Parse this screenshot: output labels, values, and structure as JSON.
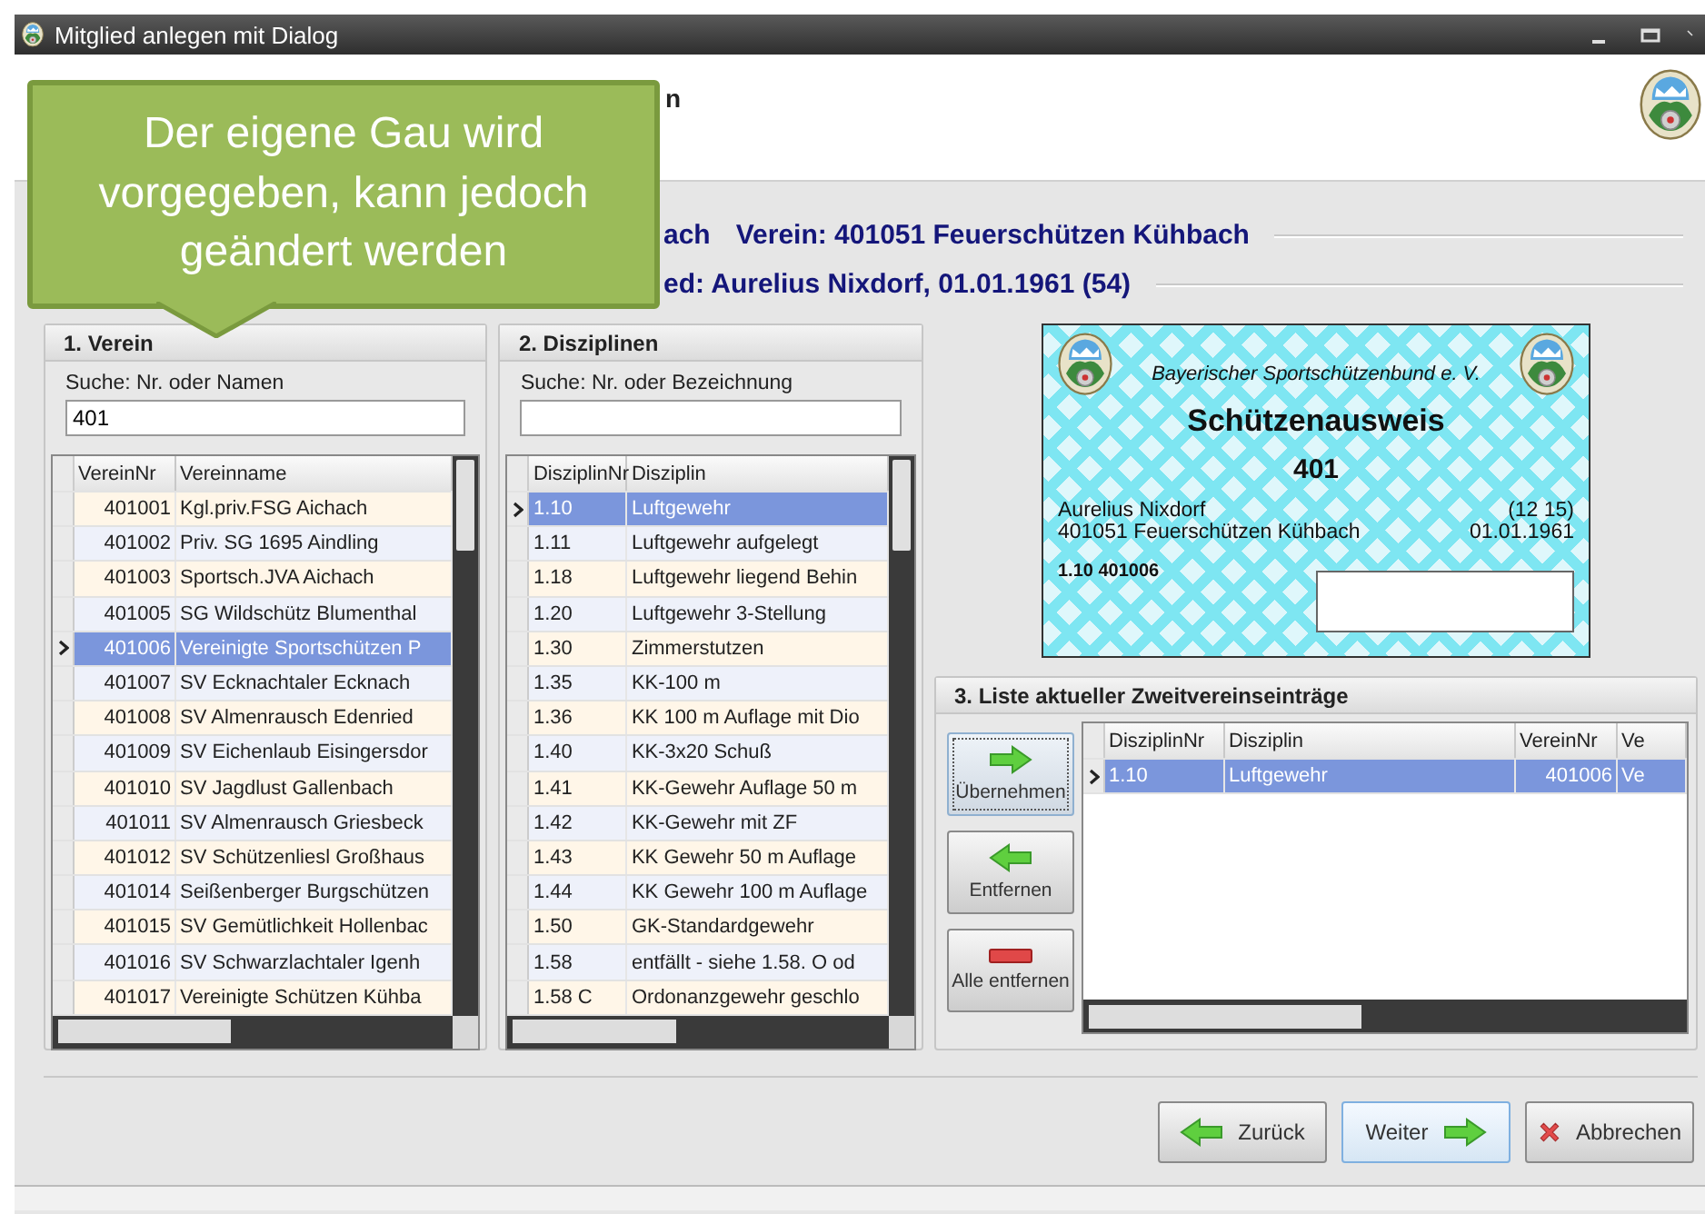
{
  "window": {
    "title": "Mitglied anlegen mit Dialog"
  },
  "header": {
    "title_fragment": "n"
  },
  "info_lines": [
    {
      "prefix": "ach",
      "text": "Verein: 401051 Feuerschützen Kühbach"
    },
    {
      "text": "ed: Aurelius Nixdorf, 01.01.1961 (54)"
    }
  ],
  "callout": {
    "text": "Der eigene Gau wird vorgegeben, kann jedoch geändert werden"
  },
  "verein": {
    "title": "1. Verein",
    "search_label": "Suche: Nr. oder Namen",
    "search_value": "401",
    "columns": [
      "VereinNr",
      "Vereinname"
    ],
    "rows": [
      {
        "nr": "401001",
        "name": "Kgl.priv.FSG Aichach",
        "selected": false
      },
      {
        "nr": "401002",
        "name": "Priv. SG 1695 Aindling",
        "selected": false
      },
      {
        "nr": "401003",
        "name": "Sportsch.JVA Aichach",
        "selected": false
      },
      {
        "nr": "401005",
        "name": "SG Wildschütz Blumenthal",
        "selected": false
      },
      {
        "nr": "401006",
        "name": "Vereinigte Sportschützen P",
        "selected": true
      },
      {
        "nr": "401007",
        "name": "SV Ecknachtaler Ecknach",
        "selected": false
      },
      {
        "nr": "401008",
        "name": "SV Almenrausch Edenried",
        "selected": false
      },
      {
        "nr": "401009",
        "name": "SV Eichenlaub Eisingersdor",
        "selected": false
      },
      {
        "nr": "401010",
        "name": "SV Jagdlust Gallenbach",
        "selected": false
      },
      {
        "nr": "401011",
        "name": "SV Almenrausch Griesbeck",
        "selected": false
      },
      {
        "nr": "401012",
        "name": "SV Schützenliesl Großhaus",
        "selected": false
      },
      {
        "nr": "401014",
        "name": "Seißenberger Burgschützen",
        "selected": false
      },
      {
        "nr": "401015",
        "name": "SV Gemütlichkeit Hollenbac",
        "selected": false
      },
      {
        "nr": "401016",
        "name": "SV Schwarzlachtaler Igenh",
        "selected": false
      },
      {
        "nr": "401017",
        "name": "Vereinigte Schützen Kühba",
        "selected": false
      }
    ]
  },
  "disziplinen": {
    "title": "2. Disziplinen",
    "search_label": "Suche: Nr. oder Bezeichnung",
    "columns": [
      "DisziplinNr",
      "Disziplin"
    ],
    "rows": [
      {
        "nr": "1.10",
        "name": "Luftgewehr",
        "selected": true
      },
      {
        "nr": "1.11",
        "name": "Luftgewehr aufgelegt",
        "selected": false
      },
      {
        "nr": "1.18",
        "name": "Luftgewehr liegend Behin",
        "selected": false
      },
      {
        "nr": "1.20",
        "name": "Luftgewehr 3-Stellung",
        "selected": false
      },
      {
        "nr": "1.30",
        "name": "Zimmerstutzen",
        "selected": false
      },
      {
        "nr": "1.35",
        "name": "KK-100 m",
        "selected": false
      },
      {
        "nr": "1.36",
        "name": "KK 100 m Auflage mit Dio",
        "selected": false
      },
      {
        "nr": "1.40",
        "name": "KK-3x20 Schuß",
        "selected": false
      },
      {
        "nr": "1.41",
        "name": "KK-Gewehr Auflage 50 m",
        "selected": false
      },
      {
        "nr": "1.42",
        "name": "KK-Gewehr mit ZF",
        "selected": false
      },
      {
        "nr": "1.43",
        "name": "KK Gewehr 50 m Auflage",
        "selected": false
      },
      {
        "nr": "1.44",
        "name": "KK Gewehr 100 m Auflage",
        "selected": false
      },
      {
        "nr": "1.50",
        "name": "GK-Standardgewehr",
        "selected": false
      },
      {
        "nr": "1.58",
        "name": "entfällt - siehe 1.58. O od",
        "selected": false
      },
      {
        "nr": "1.58 C",
        "name": "Ordonanzgewehr geschlo",
        "selected": false
      }
    ]
  },
  "card": {
    "org": "Bayerischer Sportschützenbund e. V.",
    "title": "Schützenausweis",
    "number": "401",
    "name": "Aurelius Nixdorf",
    "code": "(12 15)",
    "club": "401051 Feuerschützen Kühbach",
    "birthdate": "01.01.1961",
    "entry": "1.10 401006"
  },
  "entries": {
    "title": "3. Liste aktueller Zweitvereinseinträge",
    "buttons": [
      {
        "label": "Übernehmen",
        "kind": "add",
        "focused": true
      },
      {
        "label": "Entfernen",
        "kind": "remove",
        "focused": false
      },
      {
        "label": "Alle entfernen",
        "kind": "remove_all",
        "focused": false
      }
    ],
    "columns": [
      "DisziplinNr",
      "Disziplin",
      "VereinNr",
      "Ve"
    ],
    "rows": [
      {
        "cells": [
          "1.10",
          "Luftgewehr",
          "401006",
          "Ve"
        ],
        "selected": true
      }
    ]
  },
  "footer_buttons": [
    {
      "label": "Zurück",
      "kind": "back",
      "focused": false
    },
    {
      "label": "Weiter",
      "kind": "next",
      "focused": true
    },
    {
      "label": "Abbrechen",
      "kind": "cancel",
      "focused": false
    }
  ]
}
